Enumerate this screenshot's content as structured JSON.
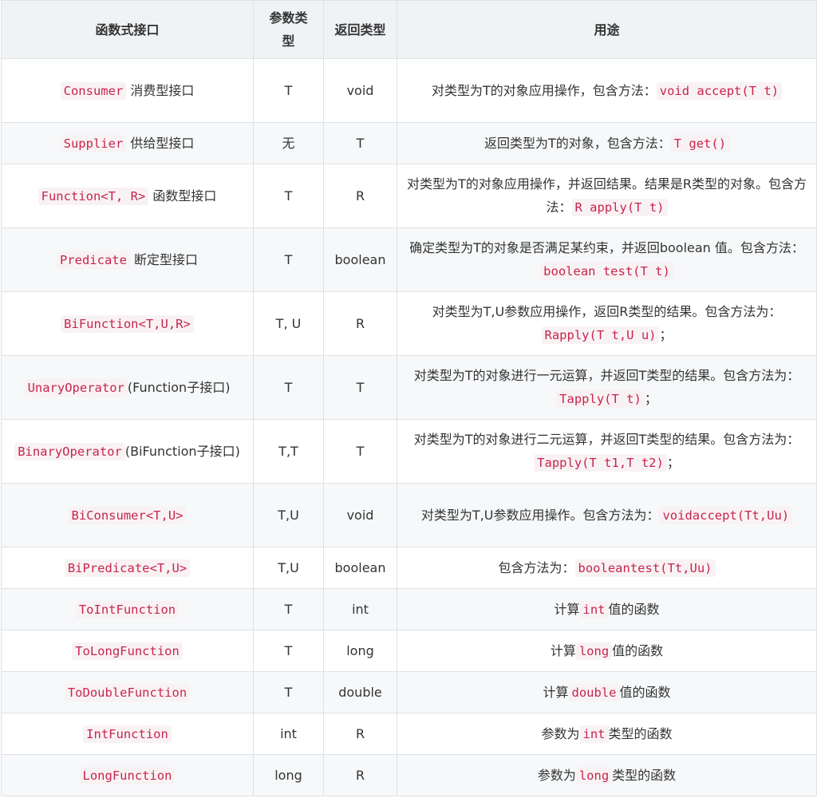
{
  "columns": [
    "函数式接口",
    "参数类型",
    "返回类型",
    "用途"
  ],
  "rows": [
    {
      "iface_code": "Consumer",
      "iface_text": " 消费型接口",
      "param": "T",
      "ret": "void",
      "use_pre": "对类型为T的对象应用操作，包含方法：",
      "use_code": "void accept(T t)",
      "use_post": ""
    },
    {
      "iface_code": "Supplier",
      "iface_text": " 供给型接口",
      "param": "无",
      "ret": "T",
      "use_pre": "返回类型为T的对象，包含方法：",
      "use_code": "T get()",
      "use_post": ""
    },
    {
      "iface_code": "Function<T, R>",
      "iface_text": " 函数型接口",
      "param": "T",
      "ret": "R",
      "use_pre": "对类型为T的对象应用操作，并返回结果。结果是R类型的对象。包含方法：",
      "use_code": "R apply(T t)",
      "use_post": ""
    },
    {
      "iface_code": "Predicate",
      "iface_text": " 断定型接口",
      "param": "T",
      "ret": "boolean",
      "use_pre": "确定类型为T的对象是否满足某约束，并返回boolean 值。包含方法：",
      "use_code": "boolean test(T t)",
      "use_post": ""
    },
    {
      "iface_code": "BiFunction<T,U,R>",
      "iface_text": "",
      "param": "T, U",
      "ret": "R",
      "use_pre": "对类型为T,U参数应用操作，返回R类型的结果。包含方法为：",
      "use_code": "Rapply(T t,U u)",
      "use_post": "；"
    },
    {
      "iface_code": "UnaryOperator",
      "iface_text": "(Function子接口)",
      "param": "T",
      "ret": "T",
      "use_pre": "对类型为T的对象进行一元运算，并返回T类型的结果。包含方法为：",
      "use_code": "Tapply(T t)",
      "use_post": "；"
    },
    {
      "iface_code": "BinaryOperator",
      "iface_text": "(BiFunction子接口)",
      "param": "T,T",
      "ret": "T",
      "use_pre": "对类型为T的对象进行二元运算，并返回T类型的结果。包含方法为：",
      "use_code": "Tapply(T t1,T t2)",
      "use_post": "；"
    },
    {
      "iface_code": "BiConsumer<T,U>",
      "iface_text": "",
      "param": "T,U",
      "ret": "void",
      "use_pre": "对类型为T,U参数应用操作。包含方法为：",
      "use_code": "voidaccept(Tt,Uu)",
      "use_post": ""
    },
    {
      "iface_code": "BiPredicate<T,U>",
      "iface_text": "",
      "param": "T,U",
      "ret": "boolean",
      "use_pre": "包含方法为：",
      "use_code": "booleantest(Tt,Uu)",
      "use_post": ""
    },
    {
      "iface_code": "ToIntFunction",
      "iface_text": "",
      "param": "T",
      "ret": "int",
      "use_pre": "计算",
      "use_code": "int",
      "use_post": "值的函数"
    },
    {
      "iface_code": "ToLongFunction",
      "iface_text": "",
      "param": "T",
      "ret": "long",
      "use_pre": "计算",
      "use_code": "long",
      "use_post": "值的函数"
    },
    {
      "iface_code": "ToDoubleFunction",
      "iface_text": "",
      "param": "T",
      "ret": "double",
      "use_pre": "计算",
      "use_code": "double",
      "use_post": "值的函数"
    },
    {
      "iface_code": "IntFunction",
      "iface_text": "",
      "param": "int",
      "ret": "R",
      "use_pre": "参数为",
      "use_code": "int",
      "use_post": "类型的函数"
    },
    {
      "iface_code": "LongFunction",
      "iface_text": "",
      "param": "long",
      "ret": "R",
      "use_pre": "参数为",
      "use_code": "long",
      "use_post": "类型的函数"
    }
  ]
}
